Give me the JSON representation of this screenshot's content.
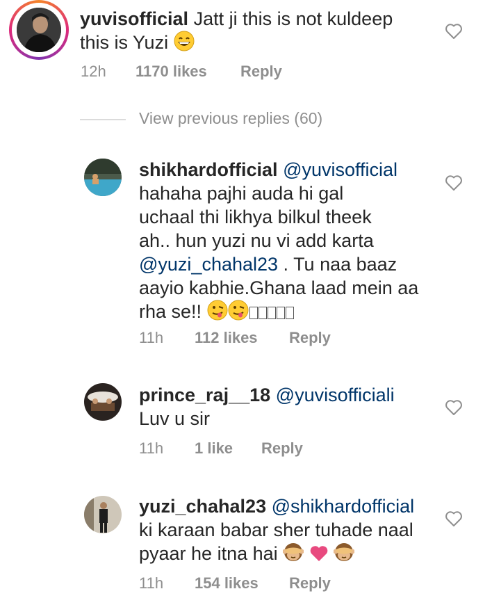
{
  "main_comment": {
    "username": "yuvisofficial",
    "text_line1": "Jatt ji this is not kuldeep",
    "text_line2": "this is Yuzi",
    "time": "12h",
    "likes": "1170 likes",
    "reply": "Reply"
  },
  "view_previous": "View previous replies (60)",
  "replies": [
    {
      "username": "shikhardofficial",
      "mention": "@yuvisofficial",
      "lines": [
        "hahaha pajhi auda hi gal",
        "uchaal thi likhya bilkul theek",
        "ah.. hun yuzi nu vi add karta"
      ],
      "mention2": "@yuzi_chahal23",
      "line_after_mention": " . Tu naa baaz",
      "line5": "aayio kabhie.Ghana laad mein aa",
      "line6": "rha se!!",
      "time": "11h",
      "likes": "112 likes",
      "reply": "Reply"
    },
    {
      "username": "prince_raj__18",
      "mention": "@yuvisofficiali",
      "lines": [
        "Luv u sir"
      ],
      "time": "11h",
      "likes": "1 like",
      "reply": "Reply"
    },
    {
      "username": "yuzi_chahal23",
      "mention": "@shikhardofficial",
      "lines": [
        "ki karaan babar sher tuhade naal",
        "pyaar he itna hai"
      ],
      "time": "11h",
      "likes": "154 likes",
      "reply": "Reply"
    }
  ],
  "icons": {
    "like": "heart-outline-icon",
    "emoji_grin": "grinning-emoji",
    "emoji_zany": "zany-face-emoji",
    "emoji_monkey": "see-no-evil-monkey-emoji",
    "emoji_heart": "pink-heart-emoji"
  },
  "colors": {
    "mention": "#003569",
    "meta": "#8e8e8e",
    "text": "#262626",
    "heart_emoji": "#e84a7f"
  }
}
